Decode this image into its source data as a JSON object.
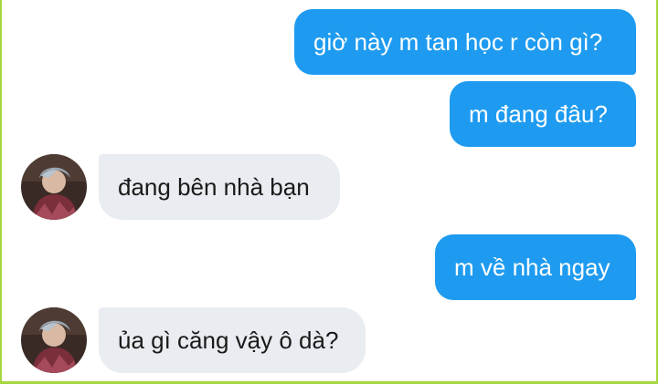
{
  "conversation": {
    "messages": [
      {
        "sender": "me",
        "text": "giờ này m tan học r còn gì?"
      },
      {
        "sender": "me",
        "text": "m đang đâu?"
      },
      {
        "sender": "them",
        "text": "đang bên nhà bạn"
      },
      {
        "sender": "me",
        "text": "m về nhà ngay"
      },
      {
        "sender": "them",
        "text": "ủa gì căng vậy ô dà?"
      }
    ]
  },
  "colors": {
    "outgoing_bubble": "#1e9bf0",
    "incoming_bubble": "#e9ecf0",
    "frame_border": "#a6d63f"
  },
  "icons": {
    "contact_avatar": "avatar-photo"
  }
}
